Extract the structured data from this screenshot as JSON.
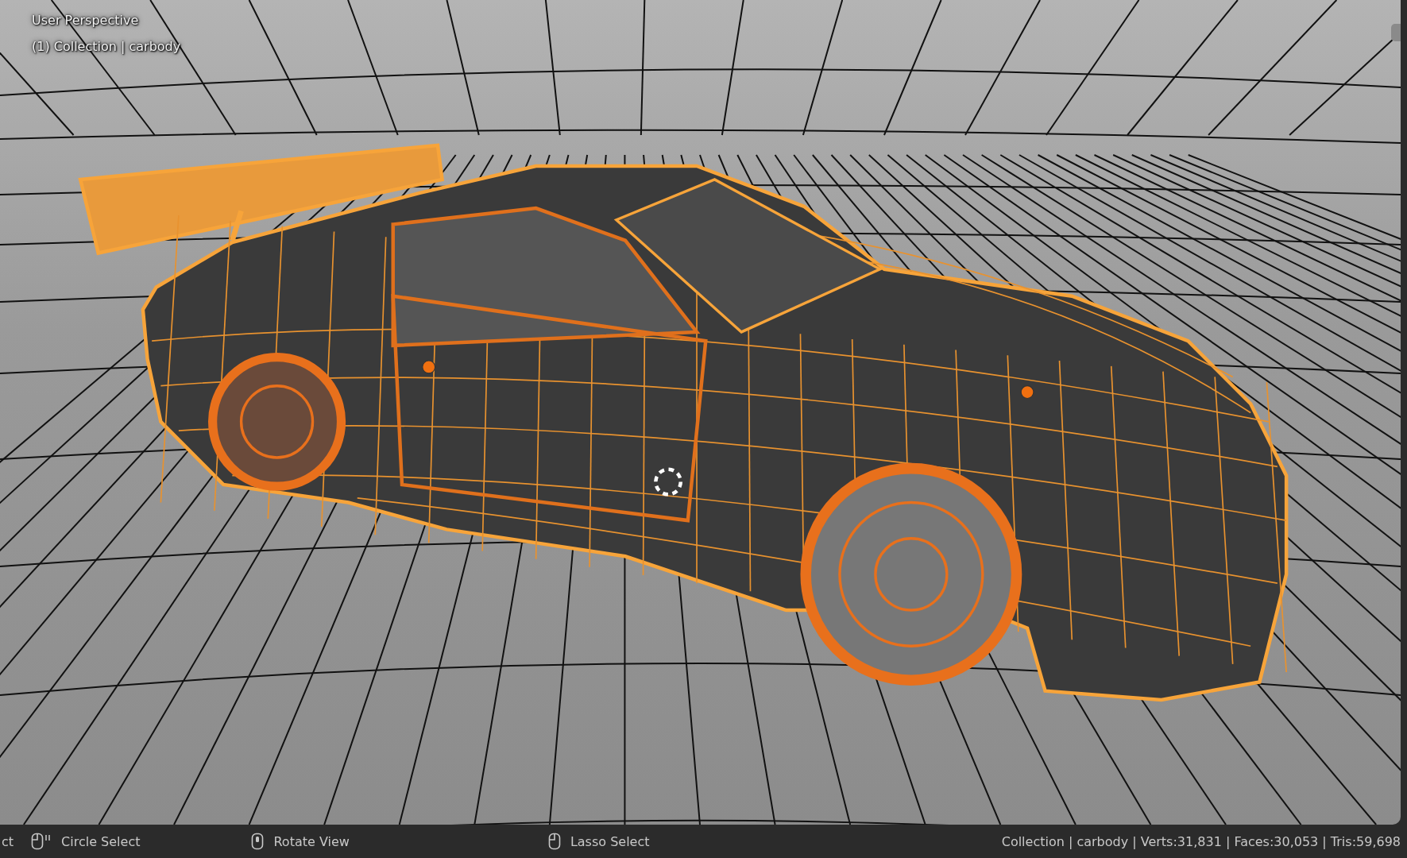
{
  "viewport": {
    "view_name": "User Perspective",
    "object_info": "(1) Collection | carbody"
  },
  "status_bar": {
    "hints": [
      {
        "kind": "none",
        "label": "ct"
      },
      {
        "kind": "mouse_left_drag",
        "label": "Circle Select"
      },
      {
        "kind": "mouse_middle",
        "label": "Rotate View"
      },
      {
        "kind": "mouse_left",
        "label": "Lasso Select"
      }
    ],
    "stats": "Collection | carbody | Verts:31,831 | Faces:30,053 | Tris:59,698"
  }
}
